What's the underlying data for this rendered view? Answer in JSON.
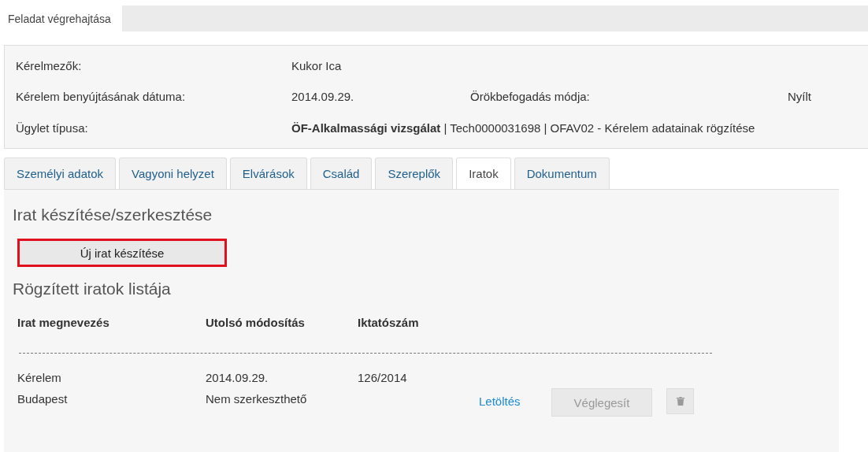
{
  "header": {
    "title": "Feladat végrehajtása"
  },
  "info": [
    {
      "label": "Kérelmezők:",
      "value": "Kukor Ica"
    },
    {
      "label": "Kérelem benyújtásának dátuma:",
      "value": "2014.09.29.",
      "label_2": "Örökbefogadás módja:",
      "value_2": "Nyílt"
    },
    {
      "label": "Ügylet típusa:",
      "value": "**ÖF-Alkalmassági vizsgálat** | Tech0000031698 | OFAV02 - Kérelem adatainak rögzítése"
    }
  ],
  "tabs": [
    {
      "label": "Személyi adatok",
      "selected": false
    },
    {
      "label": "Vagyoni helyzet",
      "selected": false
    },
    {
      "label": "Elvárások",
      "selected": false
    },
    {
      "label": "Család",
      "selected": false
    },
    {
      "label": "Szereplők",
      "selected": false
    },
    {
      "label": "Iratok",
      "selected": true
    },
    {
      "label": "Dokumentum",
      "selected": false
    }
  ],
  "section_title": "Irat készítése/szerkesztése",
  "new_button": {
    "label": "Új irat készítése",
    "highlighted": true
  },
  "list_title": "Rögzített iratok listája",
  "table": {
    "columns": [
      "Irat megnevezés",
      "Utolsó módosítás",
      "Iktatószám"
    ],
    "rows": [
      {
        "cells": [
          [
            "Kérelem",
            "Budapest"
          ],
          [
            "2014.09.29.",
            "Nem szerkeszthető"
          ],
          [
            "126/2014"
          ]
        ],
        "link": "Letöltés",
        "finalize": {
          "label": "Véglegesít",
          "disabled": true
        },
        "delete_disabled": true
      }
    ]
  }
}
